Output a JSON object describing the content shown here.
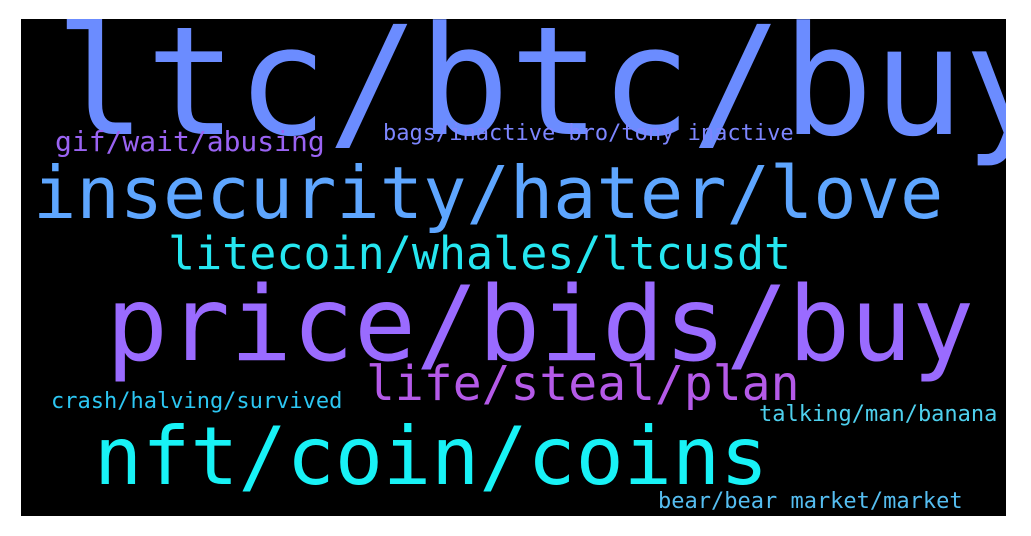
{
  "cloud": {
    "background": "#000000",
    "words": [
      {
        "id": "w1",
        "text": "ltc/btc/buy",
        "color": "#6b8cff"
      },
      {
        "id": "w2",
        "text": "gif/wait/abusing",
        "color": "#9a63f2"
      },
      {
        "id": "w3",
        "text": "bags/inactive bro/tony inactive",
        "color": "#7d86ff"
      },
      {
        "id": "w4",
        "text": "insecurity/hater/love",
        "color": "#5ea6ff"
      },
      {
        "id": "w5",
        "text": "litecoin/whales/ltcusdt",
        "color": "#26e6f0"
      },
      {
        "id": "w6",
        "text": "price/bids/buy",
        "color": "#9a6bff"
      },
      {
        "id": "w7",
        "text": "life/steal/plan",
        "color": "#b45ae8"
      },
      {
        "id": "w8",
        "text": "crash/halving/survived",
        "color": "#2cc6f2"
      },
      {
        "id": "w9",
        "text": "talking/man/banana",
        "color": "#4ed0ee"
      },
      {
        "id": "w10",
        "text": "nft/coin/coins",
        "color": "#18f2f6"
      },
      {
        "id": "w11",
        "text": "bear/bear market/market",
        "color": "#55bdf0"
      }
    ]
  }
}
